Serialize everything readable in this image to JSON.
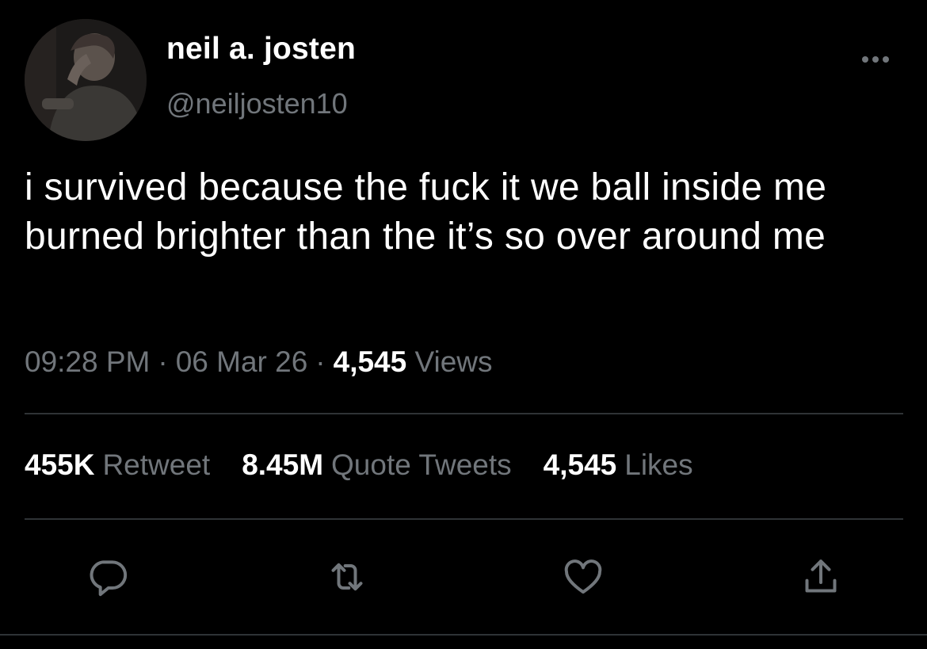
{
  "tweet": {
    "author": {
      "display_name": "neil a. josten",
      "handle": "@neiljosten10"
    },
    "text": "i survived because the fuck it we ball inside me burned brighter than the it’s so over around me",
    "meta": {
      "time": "09:28 PM",
      "separator": "·",
      "date": "06 Mar 26",
      "views_count": "4,545",
      "views_label": "Views"
    },
    "stats": {
      "retweets": {
        "count": "455K",
        "label": "Retweet"
      },
      "quotes": {
        "count": "8.45M",
        "label": "Quote Tweets"
      },
      "likes": {
        "count": "4,545",
        "label": "Likes"
      }
    },
    "actions": {
      "reply_icon": "reply-icon",
      "retweet_icon": "retweet-icon",
      "like_icon": "heart-icon",
      "share_icon": "share-icon",
      "more_icon": "more-horizontal-icon"
    }
  },
  "colors": {
    "background": "#000000",
    "primary_text": "#ffffff",
    "secondary_text": "#71767b",
    "divider": "#2f3336",
    "icon": "#71767b"
  }
}
